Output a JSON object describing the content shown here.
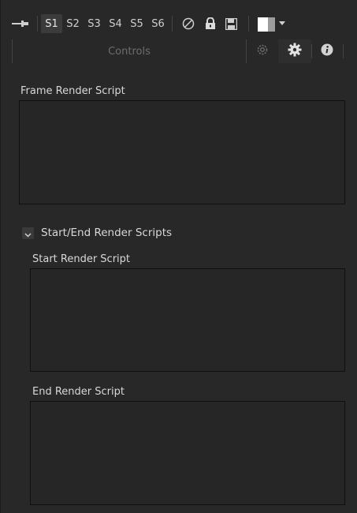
{
  "toolbar": {
    "slots": [
      "S1",
      "S2",
      "S3",
      "S4",
      "S5",
      "S6"
    ],
    "active_slot": "S1",
    "icons": [
      "pin-icon",
      "disable-icon",
      "lock-icon",
      "save-icon",
      "color-swatch",
      "dropdown-caret"
    ]
  },
  "tabs": {
    "controls_label": "Controls",
    "icons": [
      "modifiers-icon",
      "gear-icon",
      "info-icon"
    ],
    "active": "settings"
  },
  "fields": {
    "frame_render_script_label": "Frame Render Script",
    "frame_render_script_value": "",
    "start_end_checkbox_label": "Start/End Render Scripts",
    "start_end_checked": true,
    "start_render_script_label": "Start Render Script",
    "start_render_script_value": "",
    "end_render_script_label": "End Render Script",
    "end_render_script_value": ""
  },
  "colors": {
    "background": "#282828",
    "textbox": "#262626",
    "label": "#d8d8d8",
    "muted_label": "#6d6d6d"
  }
}
